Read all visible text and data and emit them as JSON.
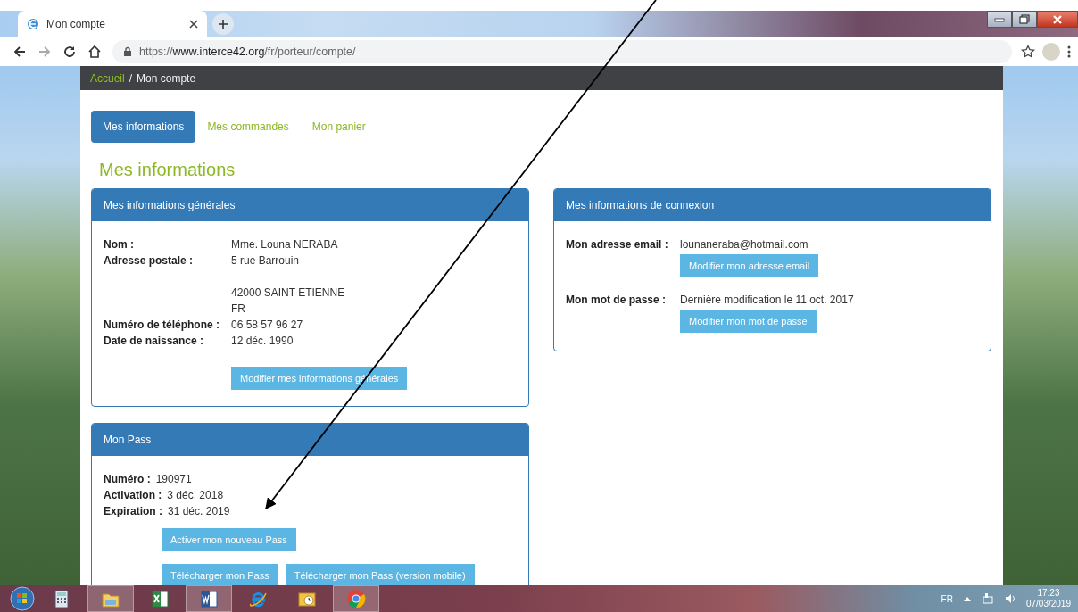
{
  "browser": {
    "tab_title": "Mon compte",
    "url": {
      "scheme": "https://",
      "host": "www.interce42.org",
      "path": "/fr/porteur/compte/"
    }
  },
  "breadcrumb": {
    "separator": "/",
    "items": [
      {
        "label": "Accueil",
        "kind": "link"
      },
      {
        "label": "Mon compte",
        "kind": "current"
      }
    ]
  },
  "nav_tabs": [
    {
      "label": "Mes informations",
      "selected": true
    },
    {
      "label": "Mes commandes",
      "selected": false
    },
    {
      "label": "Mon panier",
      "selected": false
    }
  ],
  "heading": "Mes informations",
  "columns": [
    {
      "panels": [
        {
          "title": "Mes informations générales",
          "kind": "table",
          "rows": [
            {
              "label": "Nom :",
              "kind": "text",
              "lines": [
                "Mme. Louna NERABA"
              ]
            },
            {
              "label": "Adresse postale :",
              "kind": "address",
              "blocks": [
                [
                  "5 rue Barrouin"
                ],
                [
                  "42000 SAINT ETIENNE",
                  "FR"
                ]
              ]
            },
            {
              "label": "Numéro de téléphone :",
              "kind": "text",
              "lines": [
                "06 58 57 96 27"
              ]
            },
            {
              "label": "Date de naissance :",
              "kind": "text",
              "lines": [
                "12 déc. 1990"
              ]
            }
          ],
          "button_rows": [
            [
              "Modifier mes informations générales"
            ]
          ]
        },
        {
          "title": "Mon Pass",
          "kind": "inline",
          "rows": [
            {
              "label": "Numéro :",
              "kind": "text",
              "lines": [
                "190971"
              ]
            },
            {
              "label": "Activation :",
              "kind": "text",
              "lines": [
                "3 déc. 2018"
              ]
            },
            {
              "label": "Expiration :",
              "kind": "text",
              "lines": [
                "31 déc. 2019"
              ]
            }
          ],
          "button_rows": [
            [
              "Activer mon nouveau Pass"
            ],
            [
              "Télécharger mon Pass",
              "Télécharger mon Pass (version mobile)"
            ]
          ]
        }
      ]
    },
    {
      "panels": [
        {
          "title": "Mes informations de connexion",
          "kind": "table",
          "rows": [
            {
              "label": "Mon adresse email :",
              "kind": "text",
              "lines": [
                "lounaneraba@hotmail.com"
              ],
              "button": "Modifier mon adresse email"
            },
            {
              "label": "Mon mot de passe :",
              "kind": "text",
              "lines": [
                "Dernière modification le 11 oct. 2017"
              ],
              "button": "Modifier mon mot de passe"
            }
          ]
        }
      ]
    }
  ],
  "annotation_arrow": true,
  "tray": {
    "language": "FR",
    "time": "17:23",
    "date": "07/03/2019"
  }
}
